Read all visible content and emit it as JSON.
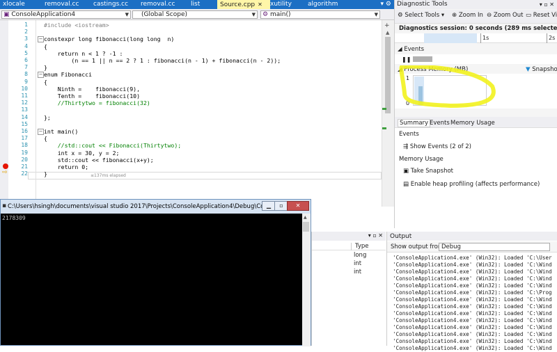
{
  "tabs": [
    {
      "label": "xlocale",
      "active": false
    },
    {
      "label": "removal.cc",
      "active": false
    },
    {
      "label": "castings.cc",
      "active": false
    },
    {
      "label": "removal.cc",
      "active": false
    },
    {
      "label": "list",
      "active": false
    },
    {
      "label": "Source.cpp",
      "active": true
    },
    {
      "label": "xutility",
      "active": false
    },
    {
      "label": "algorithm",
      "active": false
    }
  ],
  "nav": {
    "project": "ConsoleApplication4",
    "scope": "(Global Scope)",
    "member": "main()"
  },
  "code_lines": [
    {
      "n": "1",
      "text": "#include <iostream>"
    },
    {
      "n": "2",
      "text": ""
    },
    {
      "n": "3",
      "text": "constexpr long fibonacci(long long  n)"
    },
    {
      "n": "4",
      "text": "{"
    },
    {
      "n": "5",
      "text": "    return n < 1 ? -1 :"
    },
    {
      "n": "6",
      "text": "        (n == 1 || n == 2 ? 1 : fibonacci(n - 1) + fibonacci(n - 2));"
    },
    {
      "n": "7",
      "text": "}"
    },
    {
      "n": "8",
      "text": "enum Fibonacci"
    },
    {
      "n": "9",
      "text": "{"
    },
    {
      "n": "10",
      "text": "    Ninth =    fibonacci(9),"
    },
    {
      "n": "11",
      "text": "    Tenth =    fibonacci(10)"
    },
    {
      "n": "12",
      "text": "    //Thirtytwo = fibonacci(32)"
    },
    {
      "n": "13",
      "text": ""
    },
    {
      "n": "14",
      "text": "};"
    },
    {
      "n": "15",
      "text": ""
    },
    {
      "n": "16",
      "text": "int main()"
    },
    {
      "n": "17",
      "text": "{"
    },
    {
      "n": "18",
      "text": "    //std::cout << Fibonacci(Thirtytwo);"
    },
    {
      "n": "19",
      "text": "    int x = 30, y = 2;"
    },
    {
      "n": "20",
      "text": "    std::cout << fibonacci(x+y);"
    },
    {
      "n": "21",
      "text": "    return 0;"
    },
    {
      "n": "22",
      "text": "}"
    }
  ],
  "elapsed_hint": "≤137ms elapsed",
  "console": {
    "title": "C:\\Users\\hsingh\\documents\\visual studio 2017\\Projects\\ConsoleApplication4\\Debug\\ConsoleAppl...",
    "output": "2178309"
  },
  "diag": {
    "title": "Diagnostic Tools",
    "select_tools": "Select Tools",
    "zoom_in": "Zoom In",
    "zoom_out": "Zoom Out",
    "reset_view": "Reset View",
    "session": "Diagnostics session: 0 seconds (289 ms selected)",
    "ruler_label": "1s",
    "ruler_label_2": "2s",
    "events_header": "Events",
    "process_memory": "Process Memory (MB)",
    "snapshot": "Snapshot",
    "mem_max": "1",
    "mem_min": "0",
    "tabs": [
      "Summary",
      "Events",
      "Memory Usage"
    ],
    "events_section": "Events",
    "show_events": "Show Events (2 of 2)",
    "memory_section": "Memory Usage",
    "take_snapshot": "Take Snapshot",
    "heap_profiling": "Enable heap profiling (affects performance)"
  },
  "locals": {
    "type_header": "Type",
    "rows": [
      "long",
      "int",
      "int"
    ]
  },
  "output": {
    "title": "Output",
    "show_from": "Show output from:",
    "source": "Debug",
    "lines": [
      "'ConsoleApplication4.exe' (Win32): Loaded 'C:\\User",
      "'ConsoleApplication4.exe' (Win32): Loaded 'C:\\Wind",
      "'ConsoleApplication4.exe' (Win32): Loaded 'C:\\Wind",
      "'ConsoleApplication4.exe' (Win32): Loaded 'C:\\Wind",
      "'ConsoleApplication4.exe' (Win32): Loaded 'C:\\Wind",
      "'ConsoleApplication4.exe' (Win32): Loaded 'C:\\Prog",
      "'ConsoleApplication4.exe' (Win32): Loaded 'C:\\Wind",
      "'ConsoleApplication4.exe' (Win32): Loaded 'C:\\Wind",
      "'ConsoleApplication4.exe' (Win32): Loaded 'C:\\Wind",
      "'ConsoleApplication4.exe' (Win32): Loaded 'C:\\Wind",
      "'ConsoleApplication4.exe' (Win32): Loaded 'C:\\Wind",
      "'ConsoleApplication4.exe' (Win32): Loaded 'C:\\Wind",
      "'ConsoleApplication4.exe' (Win32): Loaded 'C:\\Wind",
      "'ConsoleApplication4.exe' (Win32): Loaded 'C:\\Wind"
    ]
  },
  "colors": {
    "tabstrip": "#1c6fc4",
    "active_tab": "#fff6a8",
    "highlight": "#f2f21e",
    "breakpoint": "#e51400",
    "memory_fill": "#9cc3e0"
  }
}
